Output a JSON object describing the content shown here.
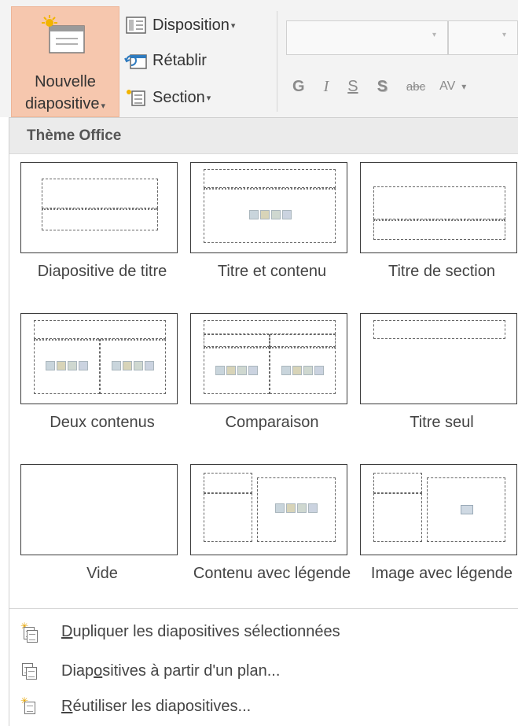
{
  "ribbon": {
    "new_slide": {
      "line1": "Nouvelle",
      "line2": "diapositive",
      "caret": "▾"
    },
    "disposition": {
      "label": "Disposition",
      "caret": "▾"
    },
    "retablir": {
      "label": "Rétablir"
    },
    "section": {
      "label": "Section",
      "caret": "▾"
    },
    "font": {
      "name_value": "",
      "size_value": "",
      "caret": "▾"
    },
    "format": {
      "bold": "G",
      "italic": "I",
      "underline": "S",
      "shadow": "S",
      "strike": "abc",
      "spacing": "AV",
      "spacing_caret": "▾"
    }
  },
  "gallery": {
    "header": "Thème Office",
    "layouts": [
      {
        "label": "Diapositive de titre"
      },
      {
        "label": "Titre et contenu"
      },
      {
        "label": "Titre de section"
      },
      {
        "label": "Deux contenus"
      },
      {
        "label": "Comparaison"
      },
      {
        "label": "Titre seul"
      },
      {
        "label": "Vide"
      },
      {
        "label": "Contenu avec légende"
      },
      {
        "label": "Image avec légende"
      }
    ]
  },
  "menu": {
    "dupliquer": {
      "underlined": "D",
      "rest": "upliquer les diapositives sélectionnées"
    },
    "plan": {
      "before": "Diap",
      "underlined": "o",
      "after": "sitives à partir d'un plan..."
    },
    "reutiliser": {
      "underlined": "R",
      "rest": "éutiliser les diapositives..."
    }
  },
  "colors": {
    "accent_highlight": "#f6c7ae",
    "ribbon_bg": "#f3f3f3",
    "header_bg": "#ebebeb"
  }
}
